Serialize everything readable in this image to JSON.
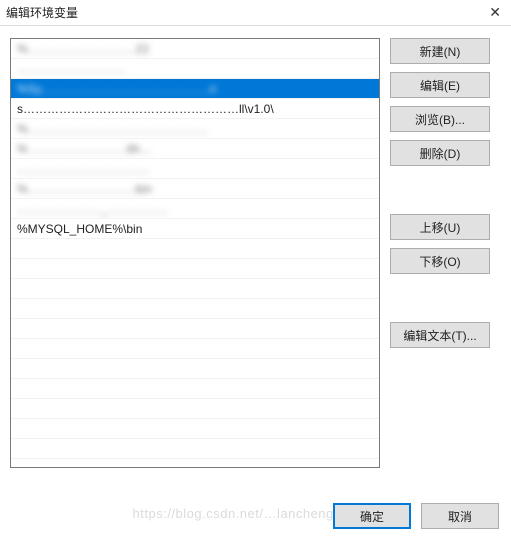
{
  "window": {
    "title": "编辑环境变量"
  },
  "list": {
    "items": [
      {
        "text": "%………………………22",
        "blurred": true,
        "selected": false
      },
      {
        "text": "………………………",
        "blurred": true,
        "selected": false
      },
      {
        "text": "%Sy……………………………………n",
        "blurred": true,
        "selected": true
      },
      {
        "text": "s………………………………………………ll\\v1.0\\",
        "blurred": false,
        "selected": false
      },
      {
        "text": "%………………………………………",
        "blurred": true,
        "selected": false
      },
      {
        "text": "% ……………………ith…",
        "blurred": true,
        "selected": false
      },
      {
        "text": "……………………………",
        "blurred": true,
        "selected": false
      },
      {
        "text": "%………………………bin",
        "blurred": true,
        "selected": false
      },
      {
        "text": "…………………_……………",
        "blurred": true,
        "selected": false
      },
      {
        "text": "%MYSQL_HOME%\\bin",
        "blurred": false,
        "selected": false
      }
    ]
  },
  "buttons": {
    "new": "新建(N)",
    "edit": "编辑(E)",
    "browse": "浏览(B)...",
    "delete": "删除(D)",
    "moveUp": "上移(U)",
    "moveDown": "下移(O)",
    "editText": "编辑文本(T)..."
  },
  "footer": {
    "ok": "确定",
    "cancel": "取消"
  },
  "watermark": "https://blog.csdn.net/…lanchengxidobai"
}
